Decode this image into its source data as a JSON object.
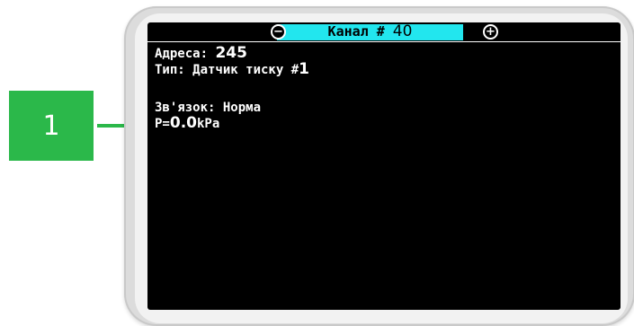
{
  "callout": {
    "number": "1"
  },
  "header": {
    "title": "Канал # ",
    "channel": "40",
    "minus_icon": "minus-circle-icon",
    "plus_icon": "plus-circle-icon"
  },
  "info": {
    "address_label": "Адреса: ",
    "address_value": "245",
    "type_label": "Тип: Датчик тиску #",
    "type_value": "1",
    "link_status": "Зв'язок: Норма",
    "pressure_prefix": "P=",
    "pressure_value": "0.0",
    "pressure_unit": "kPa"
  },
  "colors": {
    "accent": "#22e6ee",
    "callout": "#2bb84a",
    "screen_bg": "#000000",
    "text": "#ffffff"
  }
}
